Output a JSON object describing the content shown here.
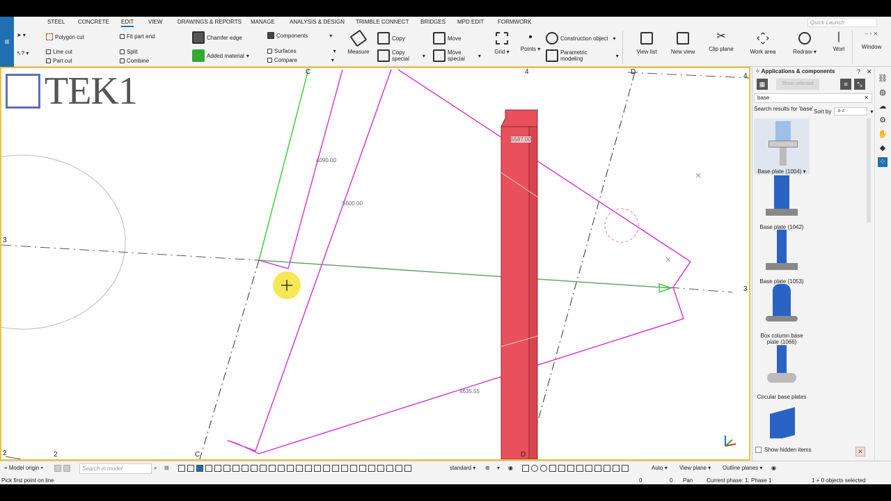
{
  "menu": {
    "tabs": [
      "STEEL",
      "CONCRETE",
      "EDIT",
      "VIEW",
      "DRAWINGS & REPORTS",
      "MANAGE",
      "ANALYSIS & DESIGN",
      "TRIMBLE CONNECT",
      "BRIDGES",
      "MPD EDIT",
      "FORMWORK"
    ],
    "active_tab": "EDIT",
    "quick_launch_placeholder": "Quick Launch"
  },
  "ribbon": {
    "polygon_cut": "Polygon cut",
    "line_cut": "Line cut",
    "part_cut": "Part cut",
    "fit_part_end": "Fit part end",
    "split": "Split",
    "combine": "Combine",
    "chamfer_edge": "Chamfer edge",
    "added_material": "Added material",
    "components": "Components",
    "surfaces": "Surfaces",
    "compare": "Compare",
    "measure": "Measure",
    "copy": "Copy",
    "copy_special_1": "Copy",
    "copy_special_2": "special",
    "move": "Move",
    "move_special_1": "Move",
    "move_special_2": "special",
    "grid": "Grid",
    "points": "Points",
    "construction_object": "Construction object",
    "parametric_modeling_1": "Parametric",
    "parametric_modeling_2": "modeling",
    "view_list": "View list",
    "new_view": "New view",
    "clip_plane": "Clip plane",
    "work_area": "Work area",
    "redraw": "Redraw",
    "worl": "Worl",
    "window": "Window"
  },
  "viewport": {
    "logo_text": "TEK1",
    "grid_labels": {
      "c_top": "C",
      "four_top": "4",
      "d_top": "D",
      "four_right": "4",
      "three_left": "3",
      "three_right": "3",
      "two_left": "2",
      "two_bottom": "2",
      "c_bottom": "C",
      "d_bottom": "D"
    },
    "dimensions": {
      "d1": "4090.00",
      "d2": "5600.00",
      "d3": "5587.00",
      "d4": "4635.55"
    }
  },
  "panel": {
    "title": "Applications & components",
    "show_selected": "Show selected",
    "search_value": "base",
    "results_label": "Search results for 'base'",
    "sort_by_label": "Sort by",
    "sort_value": "a-z",
    "items": [
      {
        "label": "Base plate (1004)",
        "selected": true
      },
      {
        "label": "Base plate (1042)"
      },
      {
        "label": "Base plate (1053)"
      },
      {
        "label": "Box column base plate (1066)"
      },
      {
        "label": "Circular base plates"
      },
      {
        "label": ""
      }
    ],
    "show_hidden_items": "Show hidden items"
  },
  "bottom_toolbar": {
    "model_origin": "Model origin",
    "search_placeholder": "Search in model",
    "standard": "standard",
    "auto": "Auto",
    "view_plane": "View plane",
    "outline_planes": "Outline planes"
  },
  "status": {
    "prompt": "Pick first point on line",
    "x": "0",
    "y": "0",
    "mode": "Pan",
    "phase": "Current phase: 1, Phase 1",
    "selected": "1 + 0 objects selected"
  },
  "colors": {
    "accent": "#1f6fb2",
    "column_red": "#e8505b",
    "magenta": "#d63ad6",
    "green": "#3ccf3c",
    "viewport_border": "#f0c040"
  }
}
